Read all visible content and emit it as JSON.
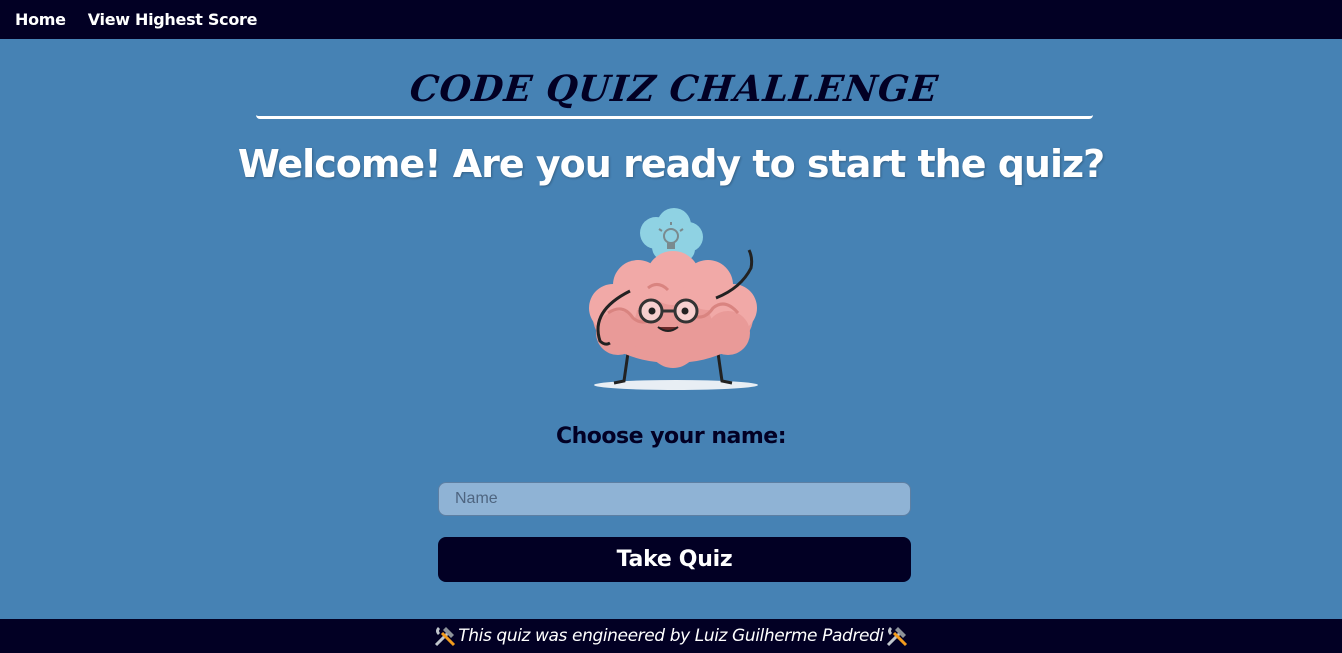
{
  "nav": {
    "items": [
      {
        "label": "Home"
      },
      {
        "label": "View Highest Score"
      }
    ]
  },
  "header": {
    "title": "CODE QUIZ CHALLENGE"
  },
  "main": {
    "welcome": "Welcome! Are you ready to start the quiz?",
    "mascot_icon": "brain-mascot-icon",
    "choose_label": "Choose your name:",
    "name_input": {
      "placeholder": "Name",
      "value": ""
    },
    "take_quiz_label": "Take Quiz"
  },
  "footer": {
    "text": "This quiz was engineered by Luiz Guilherme Padredi",
    "icon": "hammer-wrench-icon"
  },
  "colors": {
    "background": "#4682b4",
    "navbar": "#020024",
    "button": "#020024",
    "input": "#8fb3d5",
    "text_light": "#ffffff",
    "text_dark": "#020024"
  }
}
